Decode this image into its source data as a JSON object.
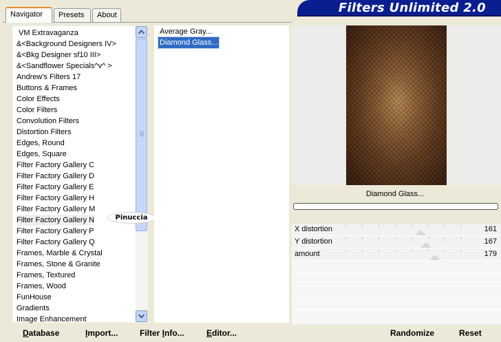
{
  "tabs": [
    {
      "label": "Navigator"
    },
    {
      "label": "Presets"
    },
    {
      "label": "About"
    }
  ],
  "banner": {
    "title": "Filters Unlimited 2.0"
  },
  "categories": [
    "VM Extravaganza",
    "&<Background Designers IV>",
    "&<Bkg Designer sf10 III>",
    "&<Sandflower Specials^v^ >",
    "Andrew's Filters 17",
    "Buttons & Frames",
    "Color Effects",
    "Color Filters",
    "Convolution Filters",
    "Distortion Filters",
    "Edges, Round",
    "Edges, Square",
    "Filter Factory Gallery C",
    "Filter Factory Gallery D",
    "Filter Factory Gallery E",
    "Filter Factory Gallery H",
    "Filter Factory Gallery M",
    "Filter Factory Gallery N",
    "Filter Factory Gallery P",
    "Filter Factory Gallery Q",
    "Frames, Marble & Crystal",
    "Frames, Stone & Granite",
    "Frames, Textured",
    "Frames, Wood",
    "FunHouse",
    "Gradients",
    "Image Enhancement"
  ],
  "selected_category": "Filter Factory Gallery N",
  "filters": [
    "Average Gray...",
    "Diamond Glass..."
  ],
  "selected_filter": "Diamond Glass...",
  "watermark": "Pinuccia",
  "preview": {
    "filter_name": "Diamond Glass..."
  },
  "parameters": [
    {
      "label": "X distortion",
      "value": "161",
      "level": 0.63
    },
    {
      "label": "Y distortion",
      "value": "167",
      "level": 0.655
    },
    {
      "label": "amount",
      "value": "179",
      "level": 0.7
    }
  ],
  "preview_toggle": {
    "label": "preview on/off",
    "value": "1"
  },
  "buttons": {
    "database": {
      "pre": "",
      "key": "D",
      "post": "atabase"
    },
    "import": {
      "pre": "",
      "key": "I",
      "post": "mport..."
    },
    "filter_info": {
      "pre": "Filter ",
      "key": "I",
      "post": "nfo..."
    },
    "editor": {
      "pre": "",
      "key": "E",
      "post": "ditor..."
    },
    "randomize": "Randomize",
    "reset": "Reset"
  },
  "colors": {
    "banner": "#0a1f8f",
    "selection": "#316ac5",
    "active_tab_accent": "#e68b2c"
  }
}
